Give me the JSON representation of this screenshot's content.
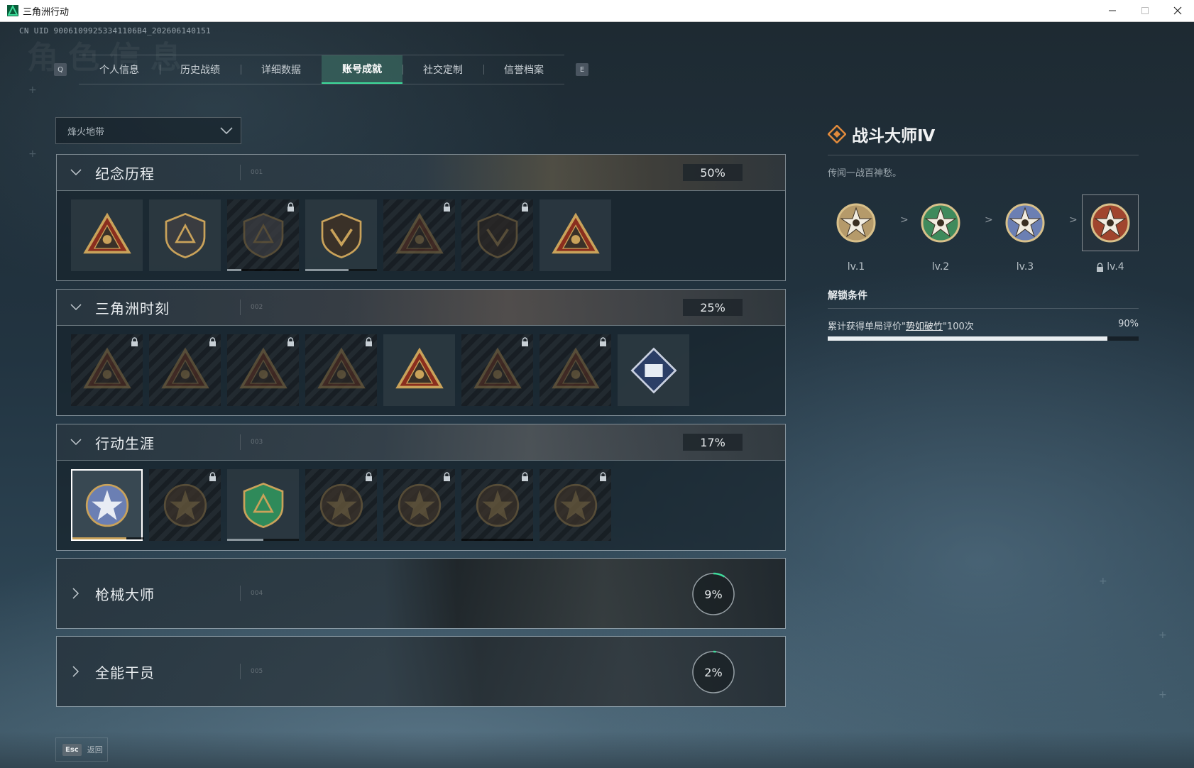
{
  "window": {
    "title": "三角洲行动"
  },
  "uid": "CN UID 90061099253341106B4_202606140151",
  "ghost_title": "角色信息",
  "tabs": {
    "prev_key": "Q",
    "next_key": "E",
    "items": [
      {
        "label": "个人信息",
        "active": false
      },
      {
        "label": "历史战绩",
        "active": false
      },
      {
        "label": "详细数据",
        "active": false
      },
      {
        "label": "账号成就",
        "active": true
      },
      {
        "label": "社交定制",
        "active": false
      },
      {
        "label": "信誉档案",
        "active": false
      }
    ]
  },
  "mode_select": {
    "value": "烽火地带"
  },
  "sections": [
    {
      "title": "纪念历程",
      "code": "001",
      "percent": "50%",
      "expanded": true,
      "badges": [
        {
          "icon": "delta-triangle-shield-icon",
          "locked": false,
          "progress": null
        },
        {
          "icon": "helicopter-shield-icon",
          "locked": false,
          "progress": null
        },
        {
          "icon": "hex-shield-emblem-icon",
          "locked": true,
          "progress": 0.2
        },
        {
          "icon": "tank-59-emblem-icon",
          "locked": false,
          "progress": 0.6
        },
        {
          "icon": "hooded-figure-triangle-icon",
          "locked": true,
          "progress": null
        },
        {
          "icon": "crossed-swords-helmet-icon",
          "locked": true,
          "progress": null
        },
        {
          "icon": "number-one-triangle-icon",
          "locked": false,
          "progress": null
        }
      ]
    },
    {
      "title": "三角洲时刻",
      "code": "002",
      "percent": "25%",
      "expanded": true,
      "badges": [
        {
          "icon": "supply-crate-triangle-icon",
          "locked": true,
          "progress": null
        },
        {
          "icon": "vest-triangle-icon",
          "locked": true,
          "progress": null
        },
        {
          "icon": "kneeling-soldier-triangle-icon",
          "locked": true,
          "progress": null
        },
        {
          "icon": "dice-triangle-icon",
          "locked": true,
          "progress": null
        },
        {
          "icon": "squad-triangle-icon",
          "locked": false,
          "progress": null
        },
        {
          "icon": "trophy-figures-triangle-icon",
          "locked": true,
          "progress": null
        },
        {
          "icon": "fish-triangle-icon",
          "locked": true,
          "progress": null
        },
        {
          "icon": "diamond-book-icon",
          "locked": false,
          "progress": null
        }
      ]
    },
    {
      "title": "行动生涯",
      "code": "003",
      "percent": "17%",
      "expanded": true,
      "badges": [
        {
          "icon": "star-laurel-medal-icon",
          "locked": false,
          "selected": true,
          "progress": 0.75
        },
        {
          "icon": "chevron-shield-medal-icon",
          "locked": true,
          "progress": null
        },
        {
          "icon": "green-star-shield-icon",
          "locked": false,
          "progress": 0.5
        },
        {
          "icon": "hexagon-star-medal-icon",
          "locked": true,
          "progress": null
        },
        {
          "icon": "shell-medal-icon",
          "locked": true,
          "progress": null
        },
        {
          "icon": "skull-crosshair-medal-icon",
          "locked": true,
          "progress": 0.0
        },
        {
          "icon": "eye-medal-icon",
          "locked": true,
          "progress": null
        }
      ]
    },
    {
      "title": "枪械大师",
      "code": "004",
      "percent": "9%",
      "progress": 0.09,
      "expanded": false
    },
    {
      "title": "全能干员",
      "code": "005",
      "percent": "2%",
      "progress": 0.02,
      "expanded": false
    }
  ],
  "detail": {
    "title": "战斗大师Ⅳ",
    "description": "传闻一战百神愁。",
    "levels": [
      {
        "label": "lv.1",
        "color": "#b59a6a",
        "locked": false
      },
      {
        "label": "lv.2",
        "color": "#3f8a5c",
        "locked": false
      },
      {
        "label": "lv.3",
        "color": "#6b7fb3",
        "locked": false
      },
      {
        "label": "lv.4",
        "color": "#a0452e",
        "locked": true,
        "current": true
      }
    ],
    "arrow": ">",
    "unlock_title": "解锁条件",
    "condition_prefix": "累计获得单局评价\"",
    "condition_highlight": "势如破竹",
    "condition_suffix": "\"100次",
    "condition_percent": "90%",
    "condition_progress": 0.9
  },
  "footer": {
    "esc_key": "Esc",
    "esc_label": "返回"
  },
  "colors": {
    "accent": "#3ddc9b",
    "gold": "#c9a25a",
    "detail_icon": "#e08a3c"
  }
}
